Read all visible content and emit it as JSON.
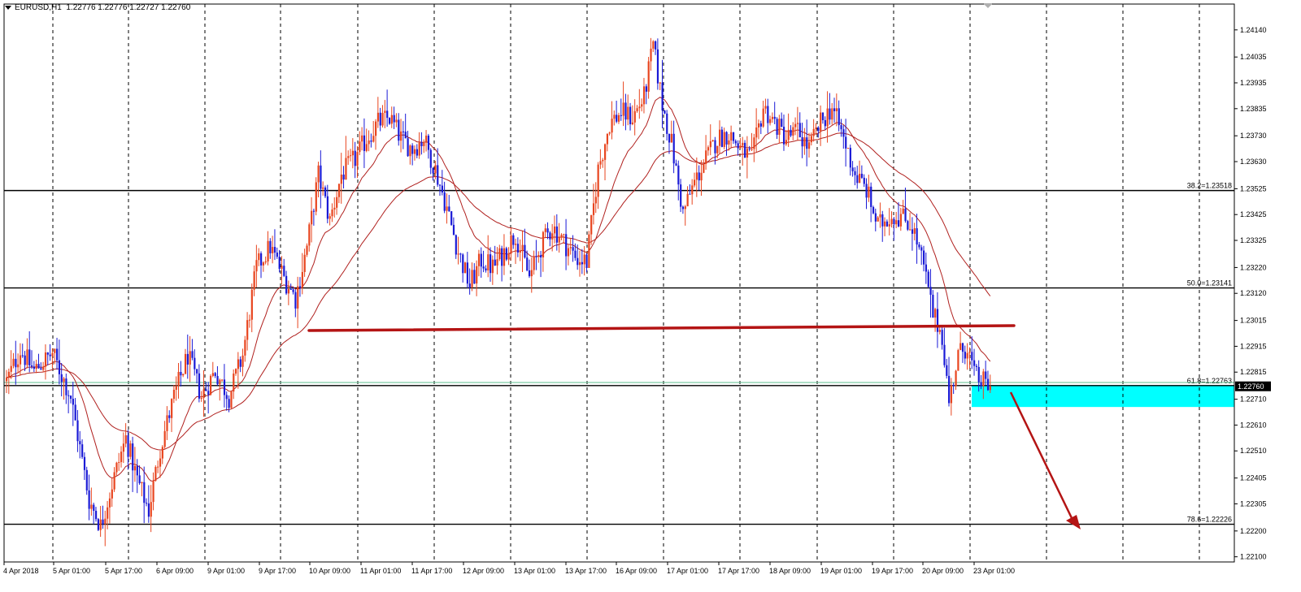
{
  "header": {
    "symbol": "EURUSD,H1",
    "quote": "1.22776 1.22776 1.22727 1.22760"
  },
  "price_tag": {
    "value": "1.22760",
    "bg": "#000000",
    "fg": "#ffffff"
  },
  "chart_data": {
    "type": "candlestick",
    "symbol": "EURUSD",
    "timeframe": "H1",
    "ylim": [
      1.2208,
      1.2424
    ],
    "x_time_labels": [
      "4 Apr 2018",
      "5 Apr 01:00",
      "5 Apr 17:00",
      "6 Apr 09:00",
      "9 Apr 01:00",
      "9 Apr 17:00",
      "10 Apr 09:00",
      "11 Apr 01:00",
      "11 Apr 17:00",
      "12 Apr 09:00",
      "13 Apr 01:00",
      "13 Apr 17:00",
      "16 Apr 09:00",
      "17 Apr 01:00",
      "17 Apr 17:00",
      "18 Apr 09:00",
      "19 Apr 01:00",
      "19 Apr 17:00",
      "20 Apr 09:00",
      "23 Apr 01:00"
    ],
    "y_ticks": [
      "1.24140",
      "1.24035",
      "1.23935",
      "1.23835",
      "1.23730",
      "1.23630",
      "1.23525",
      "1.23425",
      "1.23325",
      "1.23220",
      "1.23120",
      "1.23015",
      "1.22915",
      "1.22815",
      "1.22710",
      "1.22610",
      "1.22510",
      "1.22405",
      "1.22305",
      "1.22200",
      "1.22100"
    ],
    "fib_levels": [
      {
        "label": "38.2=1.23518",
        "price": 1.23518
      },
      {
        "label": "50.0=1.23141",
        "price": 1.23141
      },
      {
        "label": "61.8=1.22763",
        "price": 1.22763
      },
      {
        "label": "78.6=1.22226",
        "price": 1.22226
      }
    ],
    "current_price": 1.2276,
    "bid_line": 1.22775,
    "colors": {
      "bull": "#e8451f",
      "bear": "#1a1ad6",
      "ma": "#b0201e",
      "support": "#b41414",
      "zone": "#00ffff",
      "grid": "#000000"
    },
    "candle_anchors": [
      [
        0,
        1.2278
      ],
      [
        6,
        1.229
      ],
      [
        12,
        1.2282
      ],
      [
        20,
        1.2289
      ],
      [
        28,
        1.2272
      ],
      [
        36,
        1.2232
      ],
      [
        41,
        1.2222
      ],
      [
        46,
        1.2238
      ],
      [
        52,
        1.2256
      ],
      [
        57,
        1.224
      ],
      [
        62,
        1.2228
      ],
      [
        67,
        1.2252
      ],
      [
        73,
        1.2272
      ],
      [
        79,
        1.2288
      ],
      [
        85,
        1.2272
      ],
      [
        91,
        1.2282
      ],
      [
        97,
        1.2272
      ],
      [
        103,
        1.2288
      ],
      [
        109,
        1.2322
      ],
      [
        115,
        1.233
      ],
      [
        121,
        1.2318
      ],
      [
        126,
        1.231
      ],
      [
        131,
        1.233
      ],
      [
        136,
        1.2358
      ],
      [
        141,
        1.234
      ],
      [
        146,
        1.2358
      ],
      [
        152,
        1.2364
      ],
      [
        157,
        1.2372
      ],
      [
        162,
        1.2378
      ],
      [
        167,
        1.238
      ],
      [
        172,
        1.2372
      ],
      [
        177,
        1.2368
      ],
      [
        182,
        1.2372
      ],
      [
        187,
        1.236
      ],
      [
        192,
        1.2345
      ],
      [
        197,
        1.2328
      ],
      [
        202,
        1.2315
      ],
      [
        207,
        1.2325
      ],
      [
        212,
        1.2322
      ],
      [
        217,
        1.2328
      ],
      [
        222,
        1.2335
      ],
      [
        228,
        1.2318
      ],
      [
        233,
        1.233
      ],
      [
        238,
        1.2338
      ],
      [
        243,
        1.2332
      ],
      [
        248,
        1.2326
      ],
      [
        253,
        1.2324
      ],
      [
        258,
        1.236
      ],
      [
        263,
        1.2378
      ],
      [
        268,
        1.2382
      ],
      [
        273,
        1.238
      ],
      [
        278,
        1.2388
      ],
      [
        282,
        1.2408
      ],
      [
        286,
        1.2385
      ],
      [
        290,
        1.237
      ],
      [
        295,
        1.2343
      ],
      [
        300,
        1.2355
      ],
      [
        305,
        1.2364
      ],
      [
        310,
        1.2372
      ],
      [
        315,
        1.2374
      ],
      [
        320,
        1.2368
      ],
      [
        325,
        1.2364
      ],
      [
        330,
        1.2384
      ],
      [
        335,
        1.2378
      ],
      [
        340,
        1.2372
      ],
      [
        345,
        1.2375
      ],
      [
        350,
        1.2368
      ],
      [
        355,
        1.2378
      ],
      [
        360,
        1.2384
      ],
      [
        365,
        1.2372
      ],
      [
        370,
        1.2358
      ],
      [
        375,
        1.2352
      ],
      [
        380,
        1.2338
      ],
      [
        385,
        1.2342
      ],
      [
        390,
        1.2342
      ],
      [
        395,
        1.2338
      ],
      [
        400,
        1.2322
      ],
      [
        404,
        1.2304
      ],
      [
        408,
        1.2296
      ],
      [
        411,
        1.227
      ],
      [
        415,
        1.2288
      ],
      [
        419,
        1.2292
      ],
      [
        422,
        1.228
      ],
      [
        425,
        1.2278
      ],
      [
        429,
        1.2276
      ]
    ]
  }
}
